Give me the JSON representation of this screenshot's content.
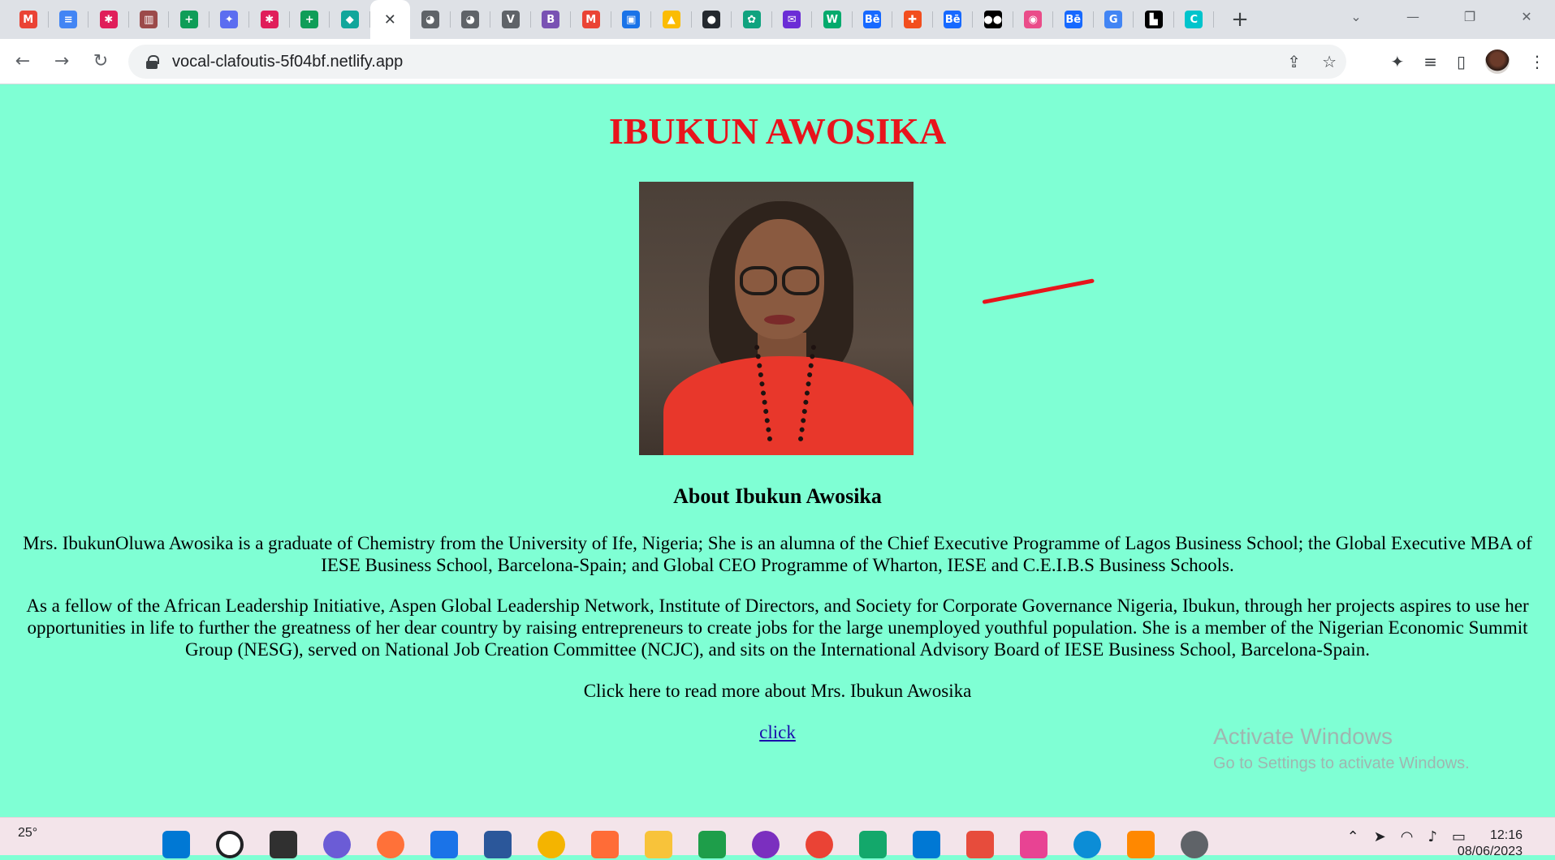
{
  "browser": {
    "tabs": [
      {
        "icon": "gmail-icon",
        "glyph": "M",
        "color": "#ea4335"
      },
      {
        "icon": "google-docs-icon",
        "glyph": "≡",
        "color": "#4285f4"
      },
      {
        "icon": "slack-icon",
        "glyph": "✱",
        "color": "#e01e5a"
      },
      {
        "icon": "site-icon",
        "glyph": "▥",
        "color": "#9c4a4a"
      },
      {
        "icon": "google-sheets-icon",
        "glyph": "+",
        "color": "#0f9d58"
      },
      {
        "icon": "gemini-icon",
        "glyph": "✦",
        "color": "#5b6df0"
      },
      {
        "icon": "slack-icon",
        "glyph": "✱",
        "color": "#e01e5a"
      },
      {
        "icon": "google-sheets-icon",
        "glyph": "+",
        "color": "#0f9d58"
      },
      {
        "icon": "diamond-icon",
        "glyph": "◆",
        "color": "#11a69b"
      },
      {
        "icon": "close-icon",
        "glyph": "✕",
        "color": "#ffffff",
        "active": true
      },
      {
        "icon": "globe-icon",
        "glyph": "◕",
        "color": "#5f6368"
      },
      {
        "icon": "globe-icon",
        "glyph": "◕",
        "color": "#5f6368"
      },
      {
        "icon": "v-icon",
        "glyph": "V",
        "color": "#5f6368"
      },
      {
        "icon": "bootstrap-icon",
        "glyph": "B",
        "color": "#7952b3"
      },
      {
        "icon": "gmail-icon",
        "glyph": "M",
        "color": "#ea4335"
      },
      {
        "icon": "contacts-icon",
        "glyph": "▣",
        "color": "#1a73e8"
      },
      {
        "icon": "google-drive-icon",
        "glyph": "▲",
        "color": "#fbbc04"
      },
      {
        "icon": "github-icon",
        "glyph": "●",
        "color": "#24292f"
      },
      {
        "icon": "chatgpt-icon",
        "glyph": "✿",
        "color": "#10a37f"
      },
      {
        "icon": "mail-icon",
        "glyph": "✉",
        "color": "#6b2dd6"
      },
      {
        "icon": "w3schools-icon",
        "glyph": "W",
        "color": "#04aa6d"
      },
      {
        "icon": "behance-icon",
        "glyph": "Bē",
        "color": "#1769ff"
      },
      {
        "icon": "figma-icon",
        "glyph": "✚",
        "color": "#f24e1e"
      },
      {
        "icon": "behance-icon",
        "glyph": "Bē",
        "color": "#1769ff"
      },
      {
        "icon": "medium-icon",
        "glyph": "●●",
        "color": "#000000"
      },
      {
        "icon": "dribbble-icon",
        "glyph": "◉",
        "color": "#ea4c89"
      },
      {
        "icon": "behance-icon",
        "glyph": "Bē",
        "color": "#1769ff"
      },
      {
        "icon": "google-icon",
        "glyph": "G",
        "color": "#4285f4"
      },
      {
        "icon": "unsplash-icon",
        "glyph": "▙",
        "color": "#000000"
      },
      {
        "icon": "canva-icon",
        "glyph": "C",
        "color": "#00c4cc"
      }
    ],
    "url": "vocal-clafoutis-5f04bf.netlify.app"
  },
  "page": {
    "title": "IBUKUN AWOSIKA",
    "about_heading": "About Ibukun Awosika",
    "paragraph1": "Mrs. IbukunOluwa Awosika is a graduate of Chemistry from the University of Ife, Nigeria; She is an alumna of the Chief Executive Programme of Lagos Business School; the Global Executive MBA of IESE Business School, Barcelona-Spain; and Global CEO Programme of Wharton, IESE and C.E.I.B.S Business Schools.",
    "paragraph2": "As a fellow of the African Leadership Initiative, Aspen Global Leadership Network, Institute of Directors, and Society for Corporate Governance Nigeria, Ibukun, through her projects aspires to use her opportunities in life to further the greatness of her dear country by raising entrepreneurs to create jobs for the large unemployed youthful population. She is a member of the Nigerian Economic Summit Group (NESG), served on National Job Creation Committee (NCJC), and sits on the International Advisory Board of IESE Business School, Barcelona-Spain.",
    "read_more": "Click here to read more about Mrs. Ibukun Awosika",
    "link_label": "click",
    "background": "#7fffd4",
    "title_color": "#e8141c"
  },
  "watermark": {
    "line1": "Activate Windows",
    "line2": "Go to Settings to activate Windows."
  },
  "taskbar": {
    "weather": "25°",
    "time": "12:16",
    "date": "08/06/2023"
  }
}
